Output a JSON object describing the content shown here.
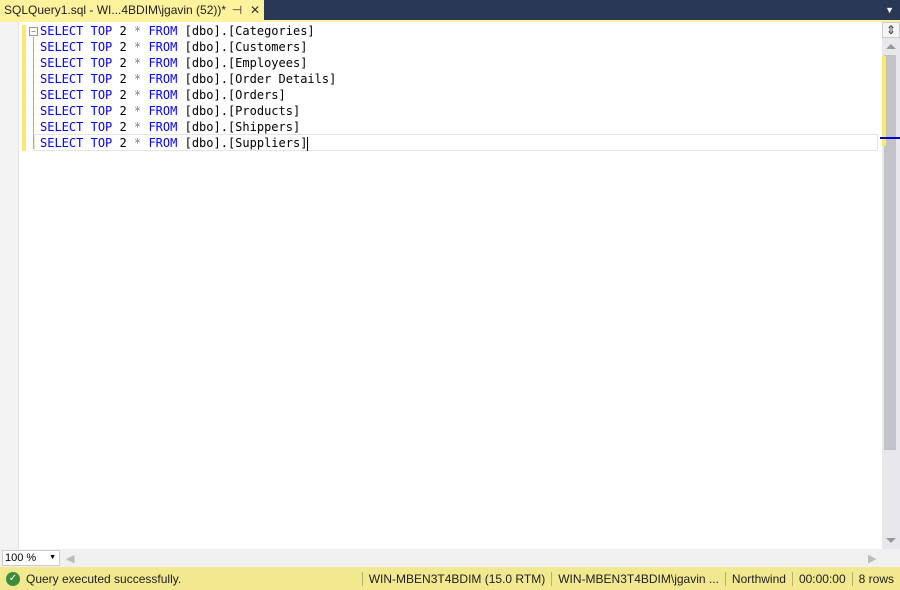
{
  "tab": {
    "title": "SQLQuery1.sql - WI...4BDIM\\jgavin (52))*",
    "pin": "⊣",
    "close": "✕"
  },
  "editor": {
    "lines": [
      {
        "kw1": "SELECT",
        "kw2": "TOP",
        "n": "2",
        "star": "*",
        "kw3": "FROM",
        "obj": "[dbo].[Categories]"
      },
      {
        "kw1": "SELECT",
        "kw2": "TOP",
        "n": "2",
        "star": "*",
        "kw3": "FROM",
        "obj": "[dbo].[Customers]"
      },
      {
        "kw1": "SELECT",
        "kw2": "TOP",
        "n": "2",
        "star": "*",
        "kw3": "FROM",
        "obj": "[dbo].[Employees]"
      },
      {
        "kw1": "SELECT",
        "kw2": "TOP",
        "n": "2",
        "star": "*",
        "kw3": "FROM",
        "obj": "[dbo].[Order Details]"
      },
      {
        "kw1": "SELECT",
        "kw2": "TOP",
        "n": "2",
        "star": "*",
        "kw3": "FROM",
        "obj": "[dbo].[Orders]"
      },
      {
        "kw1": "SELECT",
        "kw2": "TOP",
        "n": "2",
        "star": "*",
        "kw3": "FROM",
        "obj": "[dbo].[Products]"
      },
      {
        "kw1": "SELECT",
        "kw2": "TOP",
        "n": "2",
        "star": "*",
        "kw3": "FROM",
        "obj": "[dbo].[Shippers]"
      },
      {
        "kw1": "SELECT",
        "kw2": "TOP",
        "n": "2",
        "star": "*",
        "kw3": "FROM",
        "obj": "[dbo].[Suppliers]"
      }
    ]
  },
  "zoom": {
    "value": "100 %"
  },
  "status": {
    "message": "Query executed successfully.",
    "server": "WIN-MBEN3T4BDIM (15.0 RTM)",
    "user": "WIN-MBEN3T4BDIM\\jgavin ...",
    "database": "Northwind",
    "elapsed": "00:00:00",
    "rows": "8 rows"
  }
}
